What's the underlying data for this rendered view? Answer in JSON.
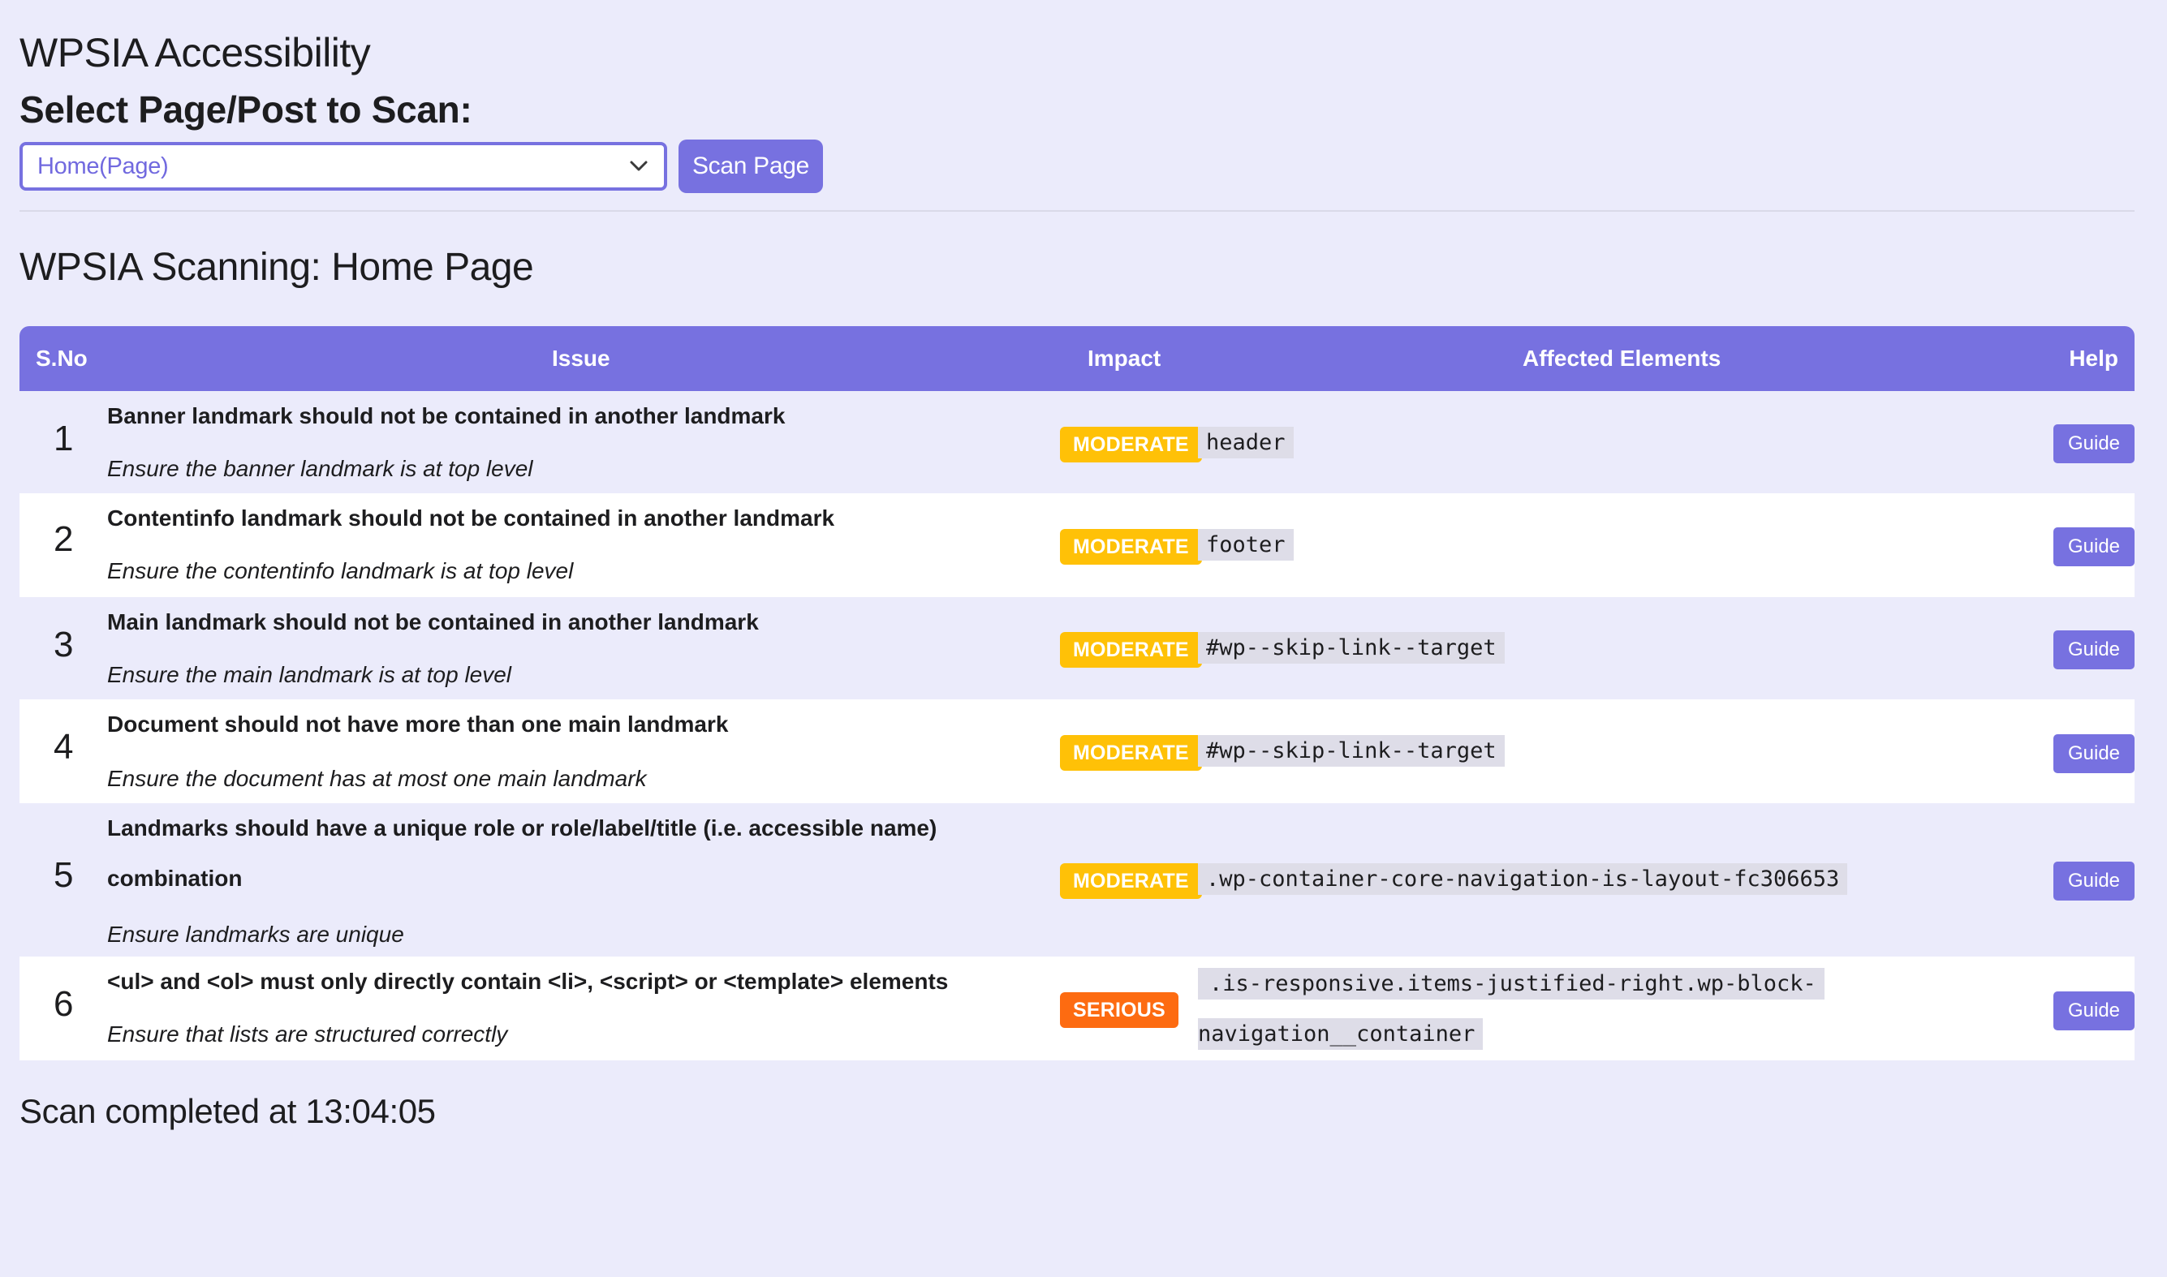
{
  "app": {
    "title": "WPSIA Accessibility"
  },
  "scan_form": {
    "heading": "Select Page/Post to Scan:",
    "selected_page": "Home(Page)",
    "scan_button": "Scan Page"
  },
  "results": {
    "heading": "WPSIA Scanning: Home Page",
    "columns": {
      "sno": "S.No",
      "issue": "Issue",
      "impact": "Impact",
      "affected": "Affected Elements",
      "help": "Help"
    },
    "rows": [
      {
        "sno": "1",
        "title": "Banner landmark should not be contained in another landmark",
        "title_line2": "",
        "description": "Ensure the banner landmark is at top level",
        "impact": "MODERATE",
        "element": "header",
        "element_line2": "",
        "help": "Guide"
      },
      {
        "sno": "2",
        "title": "Contentinfo landmark should not be contained in another landmark",
        "title_line2": "",
        "description": "Ensure the contentinfo landmark is at top level",
        "impact": "MODERATE",
        "element": "footer",
        "element_line2": "",
        "help": "Guide"
      },
      {
        "sno": "3",
        "title": "Main landmark should not be contained in another landmark",
        "title_line2": "",
        "description": "Ensure the main landmark is at top level",
        "impact": "MODERATE",
        "element": "#wp--skip-link--target",
        "element_line2": "",
        "help": "Guide"
      },
      {
        "sno": "4",
        "title": "Document should not have more than one main landmark",
        "title_line2": "",
        "description": "Ensure the document has at most one main landmark",
        "impact": "MODERATE",
        "element": "#wp--skip-link--target",
        "element_line2": "",
        "help": "Guide"
      },
      {
        "sno": "5",
        "title": "Landmarks should have a unique role or role/label/title (i.e. accessible name)",
        "title_line2": "combination",
        "description": "Ensure landmarks are unique",
        "impact": "MODERATE",
        "element": ".wp-container-core-navigation-is-layout-fc306653",
        "element_line2": "",
        "help": "Guide"
      },
      {
        "sno": "6",
        "title": "<ul> and <ol> must only directly contain <li>, <script> or <template> elements",
        "title_line2": "",
        "description": "Ensure that lists are structured correctly",
        "impact": "SERIOUS",
        "element": ".is-responsive.items-justified-right.wp-block-",
        "element_line2": "navigation__container",
        "help": "Guide"
      }
    ],
    "completed": "Scan completed at 13:04:05"
  },
  "colors": {
    "accent": "#7771e0",
    "page_background": "#ebebfb",
    "moderate": "#ffc107",
    "serious": "#fd6b11"
  },
  "icons": {
    "select_chevron": "chevron-down-icon"
  }
}
